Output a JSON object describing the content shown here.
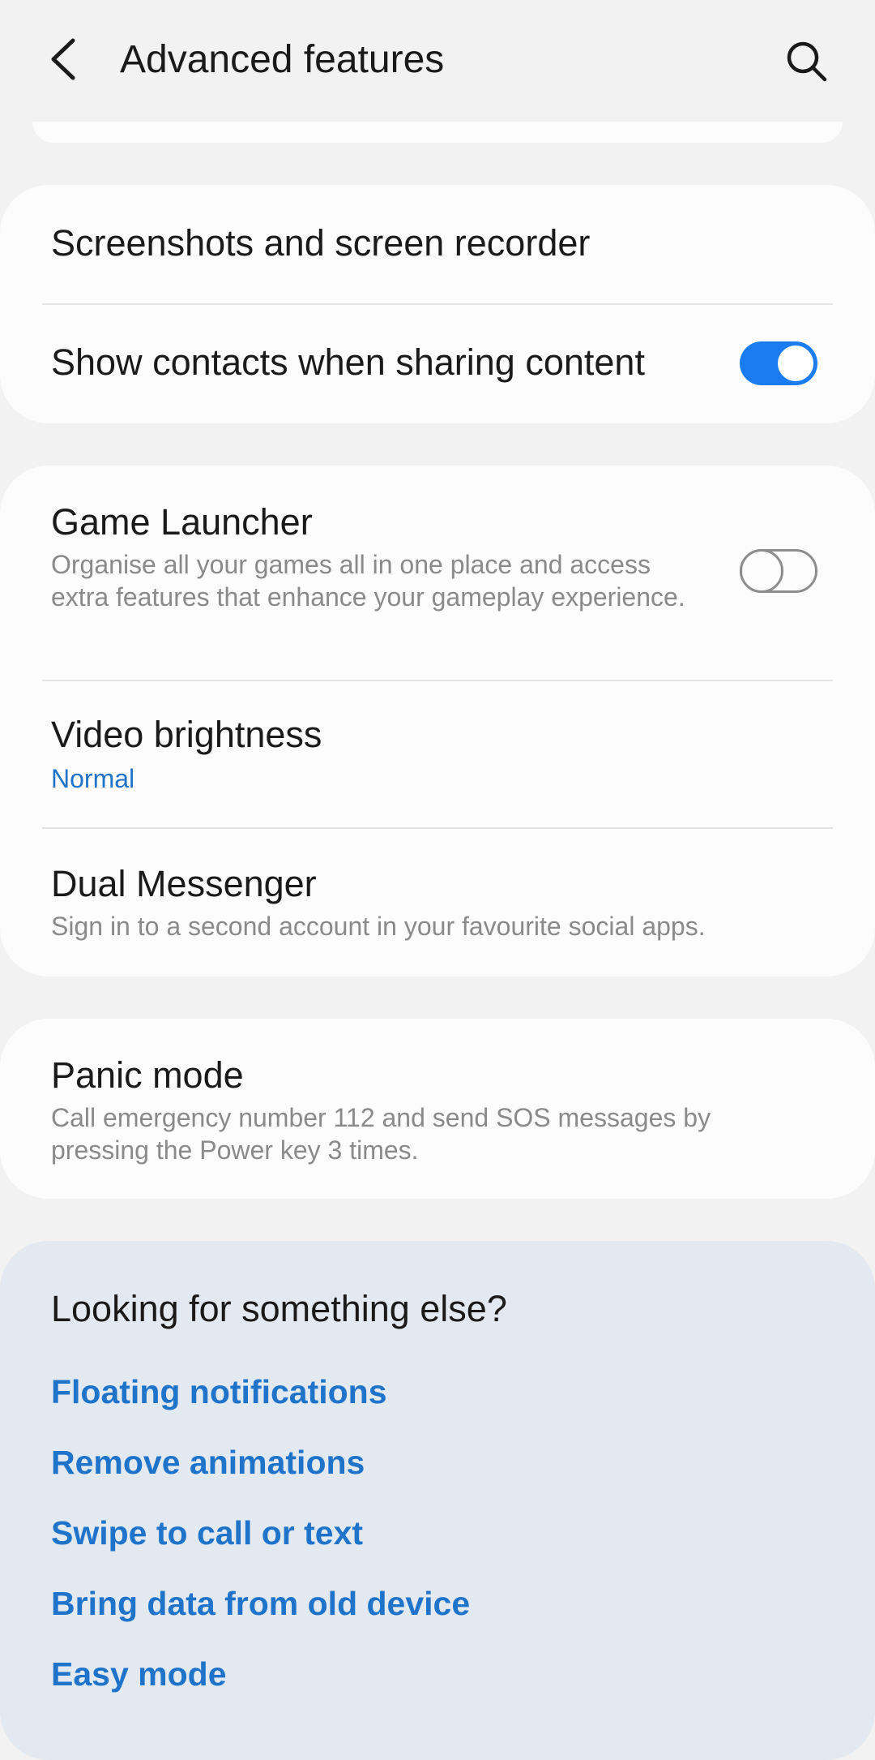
{
  "header": {
    "title": "Advanced features",
    "back_icon": "chevron-left-icon",
    "search_icon": "search-icon"
  },
  "group1": {
    "items": [
      {
        "title": "Screenshots and screen recorder"
      },
      {
        "title": "Show contacts when sharing content",
        "toggle": true
      }
    ]
  },
  "group2": {
    "items": [
      {
        "title": "Game Launcher",
        "subtitle": "Organise all your games all in one place and access extra features that enhance your gameplay experience.",
        "toggle": false
      },
      {
        "title": "Video brightness",
        "value": "Normal"
      },
      {
        "title": "Dual Messenger",
        "subtitle": "Sign in to a second account in your favourite social apps."
      }
    ]
  },
  "group3": {
    "items": [
      {
        "title": "Panic mode",
        "subtitle": "Call emergency number 112 and send SOS messages by pressing the Power key 3 times."
      }
    ]
  },
  "suggestions": {
    "title": "Looking for something else?",
    "links": [
      "Floating notifications",
      "Remove animations",
      "Swipe to call or text",
      "Bring data from old device",
      "Easy mode"
    ]
  },
  "colors": {
    "accent": "#1a7cf0",
    "link": "#1f74c9",
    "background": "#f2f2f2",
    "card": "#fcfcfc",
    "suggestion_card": "#e3e9f1"
  }
}
